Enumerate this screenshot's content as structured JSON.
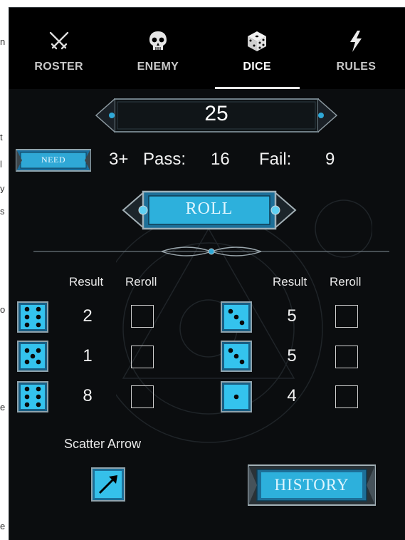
{
  "tabs": [
    {
      "label": "ROSTER",
      "icon": "crossed-swords-icon",
      "active": false
    },
    {
      "label": "ENEMY",
      "icon": "skull-icon",
      "active": false
    },
    {
      "label": "DICE",
      "icon": "dice-icon",
      "active": true
    },
    {
      "label": "RULES",
      "icon": "lightning-icon",
      "active": false
    }
  ],
  "counter": {
    "value": "25"
  },
  "need": {
    "button_label": "NEED",
    "value": "3+"
  },
  "stats": {
    "pass_label": "Pass:",
    "pass_value": "16",
    "fail_label": "Fail:",
    "fail_value": "9"
  },
  "roll": {
    "label": "ROLL"
  },
  "columns": {
    "result": "Result",
    "reroll": "Reroll"
  },
  "left_dice": [
    {
      "face": 6,
      "result": "2",
      "reroll": false
    },
    {
      "face": 5,
      "result": "1",
      "reroll": false
    },
    {
      "face": 6,
      "result": "8",
      "reroll": false
    }
  ],
  "right_dice": [
    {
      "face": 3,
      "result": "5",
      "reroll": false
    },
    {
      "face": 3,
      "result": "5",
      "reroll": false
    },
    {
      "face": 1,
      "result": "4",
      "reroll": false
    }
  ],
  "scatter": {
    "label": "Scatter Arrow",
    "icon": "arrow-up-right-icon"
  },
  "history": {
    "label": "HISTORY"
  },
  "left_strip": [
    "n",
    "t",
    "l",
    "y",
    "s",
    "o",
    "e",
    "e"
  ],
  "colors": {
    "accent": "#2fa8d6",
    "panel": "#0b0d0f",
    "tabbar": "#000000"
  }
}
